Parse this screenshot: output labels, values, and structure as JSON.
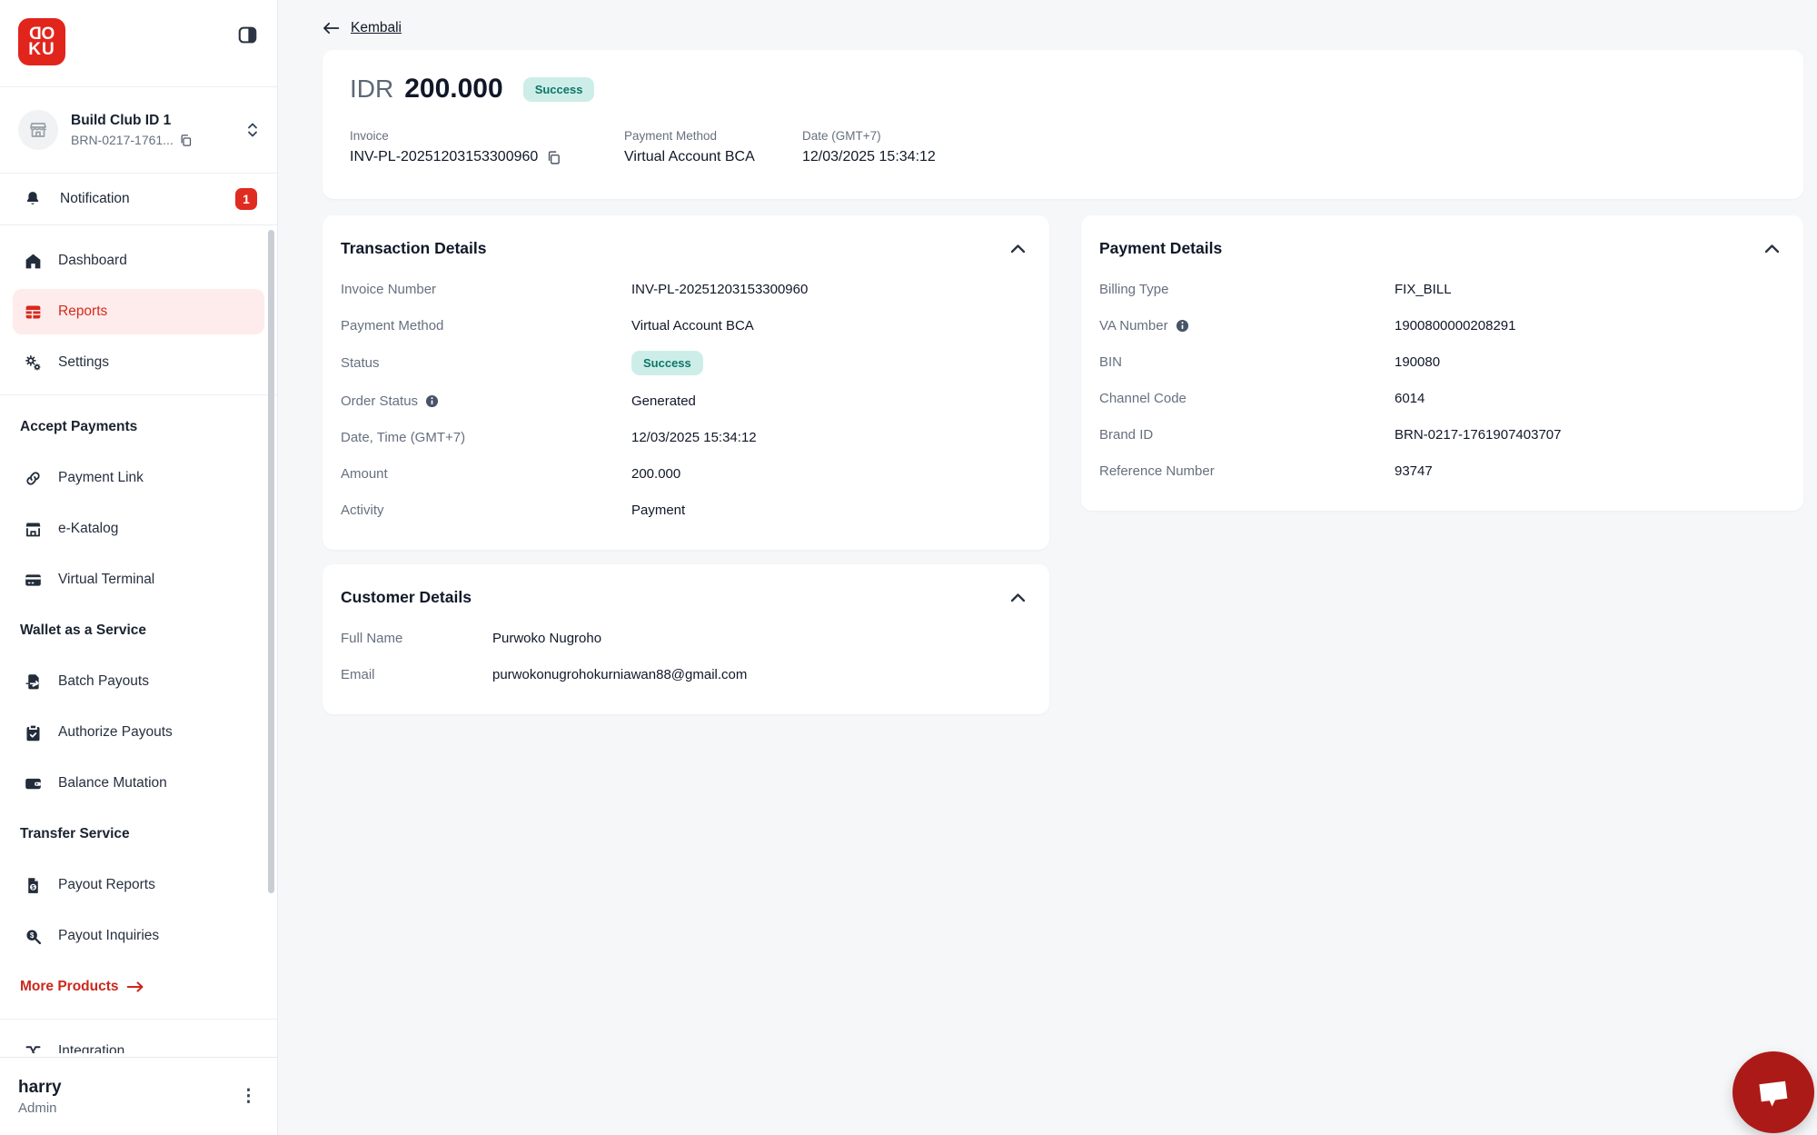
{
  "brand": {
    "logo_line1": "DO",
    "logo_line2": "KU"
  },
  "sidebar": {
    "merchant": {
      "name": "Build Club ID 1",
      "id": "BRN-0217-1761..."
    },
    "notification": {
      "label": "Notification",
      "badge": "1"
    },
    "nav": [
      {
        "label": "Dashboard"
      },
      {
        "label": "Reports"
      },
      {
        "label": "Settings"
      }
    ],
    "sections": [
      {
        "header": "Accept Payments",
        "items": [
          {
            "label": "Payment Link"
          },
          {
            "label": "e-Katalog"
          },
          {
            "label": "Virtual Terminal"
          }
        ]
      },
      {
        "header": "Wallet as a Service",
        "items": [
          {
            "label": "Batch Payouts"
          },
          {
            "label": "Authorize Payouts"
          },
          {
            "label": "Balance Mutation"
          }
        ]
      },
      {
        "header": "Transfer Service",
        "items": [
          {
            "label": "Payout Reports"
          },
          {
            "label": "Payout Inquiries"
          }
        ]
      }
    ],
    "more_products": "More Products",
    "partial_item": "Integration",
    "user": {
      "name": "harry",
      "role": "Admin"
    }
  },
  "header": {
    "back": "Kembali"
  },
  "summary": {
    "currency": "IDR",
    "amount": "200.000",
    "status": "Success",
    "fields": [
      {
        "label": "Invoice",
        "value": "INV-PL-20251203153300960"
      },
      {
        "label": "Payment Method",
        "value": "Virtual Account BCA"
      },
      {
        "label": "Date (GMT+7)",
        "value": "12/03/2025 15:34:12"
      }
    ]
  },
  "transaction_details": {
    "title": "Transaction Details",
    "rows": [
      {
        "label": "Invoice Number",
        "value": "INV-PL-20251203153300960"
      },
      {
        "label": "Payment Method",
        "value": "Virtual Account BCA"
      },
      {
        "label": "Status",
        "value": "Success"
      },
      {
        "label": "Order Status",
        "value": "Generated"
      },
      {
        "label": "Date, Time (GMT+7)",
        "value": "12/03/2025 15:34:12"
      },
      {
        "label": "Amount",
        "value": "200.000"
      },
      {
        "label": "Activity",
        "value": "Payment"
      }
    ]
  },
  "payment_details": {
    "title": "Payment Details",
    "rows": [
      {
        "label": "Billing Type",
        "value": "FIX_BILL"
      },
      {
        "label": "VA Number",
        "value": "1900800000208291"
      },
      {
        "label": "BIN",
        "value": "190080"
      },
      {
        "label": "Channel Code",
        "value": "6014"
      },
      {
        "label": "Brand ID",
        "value": "BRN-0217-1761907403707"
      },
      {
        "label": "Reference Number",
        "value": "93747"
      }
    ]
  },
  "customer_details": {
    "title": "Customer Details",
    "rows": [
      {
        "label": "Full Name",
        "value": "Purwoko Nugroho"
      },
      {
        "label": "Email",
        "value": "purwokonugrohokurniawan88@gmail.com"
      }
    ]
  },
  "colors": {
    "brand_red": "#e1251c",
    "active_item_red": "#d9281c",
    "success_bg": "#cdeee8",
    "success_text": "#0e7569",
    "chat_fab_red": "#ac1a17"
  }
}
